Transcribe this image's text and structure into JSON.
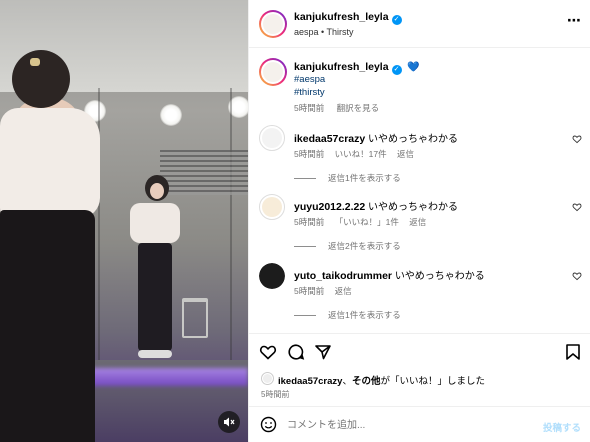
{
  "post": {
    "username": "kanjukufresh_leyla",
    "subtitle": "aespa • Thirsty",
    "caption_user": "kanjukufresh_leyla",
    "caption_emoji": "💙",
    "hashtags": [
      "#aespa",
      "#thirsty"
    ],
    "caption_time": "5時間前",
    "translate_label": "翻訳を見る"
  },
  "comments": [
    {
      "username": "ikedaa57crazy",
      "text": "いやめっちゃわかる",
      "time": "5時間前",
      "likes": "いいね！17件",
      "reply_label": "返信",
      "view_replies": "返信1件を表示する"
    },
    {
      "username": "yuyu2012.2.22",
      "text": "いやめっちゃわかる",
      "time": "5時間前",
      "likes": "「いいね！」1件",
      "reply_label": "返信",
      "view_replies": "返信2件を表示する"
    },
    {
      "username": "yuto_taikodrummer",
      "text": "いやめっちゃわかる",
      "time": "5時間前",
      "reply_label": "返信",
      "view_replies": "返信1件を表示する"
    }
  ],
  "likes_line": {
    "user": "ikedaa57crazy",
    "middle": "、",
    "others": "その他",
    "suffix": "が「いいね！」しました"
  },
  "post_time": "5時間前",
  "comment_input": {
    "placeholder": "コメントを追加...",
    "post_label": "投稿する"
  },
  "colors": {
    "verified": "#0095f6",
    "link": "#00376b",
    "post_button": "#b2dffc"
  }
}
